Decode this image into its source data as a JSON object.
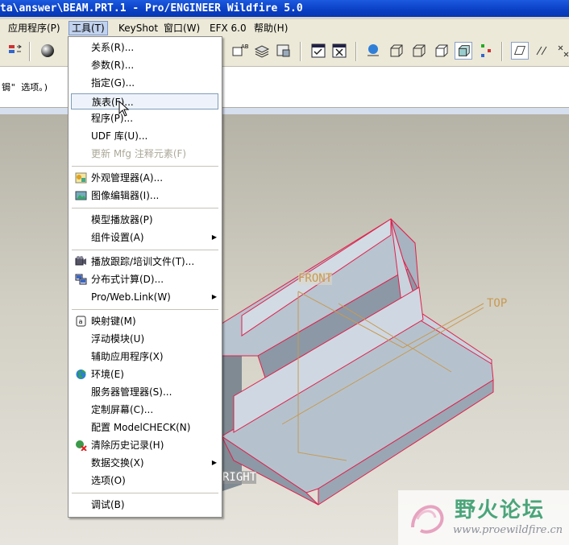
{
  "title": "ta\\answer\\BEAM.PRT.1 - Pro/ENGINEER Wildfire 5.0",
  "menubar": [
    {
      "label": "应用程序(P)",
      "name": "menu-applications"
    },
    {
      "label": "工具(T)",
      "name": "menu-tools",
      "active": true
    },
    {
      "label": "KeyShot",
      "name": "menu-keyshot"
    },
    {
      "label": "窗口(W)",
      "name": "menu-window"
    },
    {
      "label": "EFX 6.0",
      "name": "menu-efx"
    },
    {
      "label": "帮助(H)",
      "name": "menu-help"
    }
  ],
  "message": "锔\" 选项。)",
  "tools_menu": {
    "items": [
      {
        "label": "关系(R)...",
        "name": "menu-item-relations"
      },
      {
        "label": "参数(R)...",
        "name": "menu-item-parameters"
      },
      {
        "label": "指定(G)...",
        "name": "menu-item-designate"
      },
      {
        "label": "族表(F)...",
        "name": "menu-item-family-table",
        "hover": true
      },
      {
        "label": "程序(P)...",
        "name": "menu-item-program"
      },
      {
        "label": "UDF 库(U)...",
        "name": "menu-item-udf-library"
      },
      {
        "label": "更新 Mfg 注释元素(F)",
        "name": "menu-item-update-mfg",
        "disabled": true
      },
      {
        "label": "外观管理器(A)...",
        "name": "menu-item-appearance-manager",
        "icon": "appearance-icon"
      },
      {
        "label": "图像编辑器(I)...",
        "name": "menu-item-image-editor",
        "icon": "image-editor-icon"
      },
      {
        "label": "模型播放器(P)",
        "name": "menu-item-model-player"
      },
      {
        "label": "组件设置(A)",
        "name": "menu-item-component-setup",
        "submenu": true
      },
      {
        "label": "播放跟踪/培训文件(T)...",
        "name": "menu-item-play-trail",
        "icon": "trail-file-icon"
      },
      {
        "label": "分布式计算(D)...",
        "name": "menu-item-distributed-computing",
        "icon": "distributed-computing-icon"
      },
      {
        "label": "Pro/Web.Link(W)",
        "name": "menu-item-weblink",
        "submenu": true
      },
      {
        "label": "映射键(M)",
        "name": "menu-item-mapkeys",
        "icon": "mapkey-icon"
      },
      {
        "label": "浮动模块(U)",
        "name": "menu-item-floating-modules"
      },
      {
        "label": "辅助应用程序(X)",
        "name": "menu-item-auxiliary-applications"
      },
      {
        "label": "环境(E)",
        "name": "menu-item-environment",
        "icon": "environment-icon"
      },
      {
        "label": "服务器管理器(S)...",
        "name": "menu-item-server-manager"
      },
      {
        "label": "定制屏幕(C)...",
        "name": "menu-item-customize-screen"
      },
      {
        "label": "配置 ModelCHECK(N)",
        "name": "menu-item-modelcheck"
      },
      {
        "label": "清除历史记录(H)",
        "name": "menu-item-clear-history",
        "icon": "clear-history-icon"
      },
      {
        "label": "数据交换(X)",
        "name": "menu-item-data-exchange",
        "submenu": true
      },
      {
        "label": "选项(O)",
        "name": "menu-item-options"
      },
      {
        "label": "调试(B)",
        "name": "menu-item-debug"
      }
    ]
  },
  "datum_labels": {
    "front": "FRONT",
    "top": "TOP",
    "right": "RIGHT"
  },
  "watermark": {
    "title": "野火论坛",
    "url": "www.proewildfire.cn"
  },
  "colors": {
    "title_bar": "#0a3fc4",
    "menu_bg": "#ffffff",
    "model_edge": "#e0204a",
    "datum": "#c89a52",
    "watermark_text": "#4aa57a"
  }
}
